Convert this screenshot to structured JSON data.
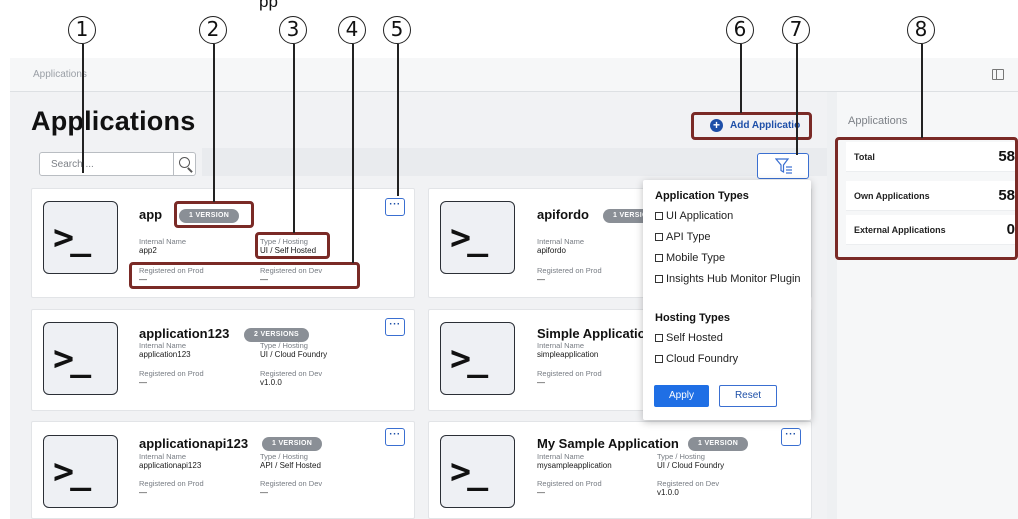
{
  "figure": {
    "title_fragment": "pp"
  },
  "callouts": [
    "1",
    "2",
    "3",
    "4",
    "5",
    "6",
    "7",
    "8"
  ],
  "breadcrumb": "Applications",
  "page_title": "Applications",
  "search": {
    "placeholder": "Search ..."
  },
  "add_button": {
    "label": "Add Applicatio"
  },
  "icons": {
    "terminal": ">_",
    "more": "···",
    "plus": "+"
  },
  "cards": [
    {
      "name": "app",
      "badge": "1 VERSION",
      "internal_name_label": "Internal Name",
      "internal_name": "app2",
      "type_label": "Type / Hosting",
      "type": "UI / Self Hosted",
      "prod_label": "Registered on Prod",
      "prod": "—",
      "dev_label": "Registered on Dev",
      "dev": "—"
    },
    {
      "name": "apifordo",
      "badge": "1 VERSIO",
      "internal_name_label": "Internal Name",
      "internal_name": "apifordo",
      "prod_label": "Registered on Prod",
      "prod": "—"
    },
    {
      "name": "application123",
      "badge": "2 VERSIONS",
      "internal_name_label": "Internal Name",
      "internal_name": "application123",
      "type_label": "Type / Hosting",
      "type": "UI / Cloud Foundry",
      "prod_label": "Registered on Prod",
      "prod": "—",
      "dev_label": "Registered on Dev",
      "dev": "v1.0.0"
    },
    {
      "name": "Simple Application",
      "internal_name_label": "Internal Name",
      "internal_name": "simpleapplication",
      "prod_label": "Registered on Prod",
      "prod": "—"
    },
    {
      "name": "applicationapi123",
      "badge": "1 VERSION",
      "internal_name_label": "Internal Name",
      "internal_name": "applicationapi123",
      "type_label": "Type / Hosting",
      "type": "API / Self Hosted",
      "prod_label": "Registered on Prod",
      "prod": "—",
      "dev_label": "Registered on Dev",
      "dev": "—"
    },
    {
      "name": "My Sample Application",
      "badge": "1 VERSION",
      "internal_name_label": "Internal Name",
      "internal_name": "mysampleapplication",
      "type_label": "Type / Hosting",
      "type": "UI / Cloud Foundry",
      "prod_label": "Registered on Prod",
      "prod": "—",
      "dev_label": "Registered on Dev",
      "dev": "v1.0.0"
    }
  ],
  "filter": {
    "app_types_heading": "Application Types",
    "app_types": [
      "UI Application",
      "API Type",
      "Mobile Type",
      "Insights Hub Monitor Plugin"
    ],
    "hosting_heading": "Hosting Types",
    "hosting_types": [
      "Self Hosted",
      "Cloud Foundry"
    ],
    "apply_label": "Apply",
    "reset_label": "Reset"
  },
  "stats_panel": {
    "title": "Applications",
    "items": [
      {
        "label": "Total",
        "value": "58"
      },
      {
        "label": "Own Applications",
        "value": "58"
      },
      {
        "label": "External Applications",
        "value": "0"
      }
    ]
  },
  "colors": {
    "accent": "#1d4fa8",
    "highlight": "#7a2a26",
    "badge": "#8a8f96",
    "apply": "#1f6fe5"
  }
}
